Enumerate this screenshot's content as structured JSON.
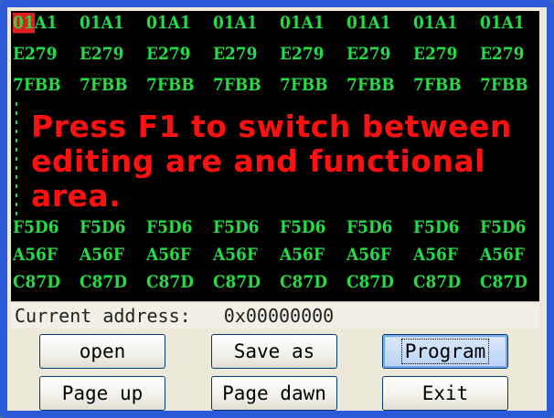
{
  "hex_rows_top": [
    [
      "01A1",
      "01A1",
      "01A1",
      "01A1",
      "01A1",
      "01A1",
      "01A1",
      "01A1"
    ],
    [
      "E279",
      "E279",
      "E279",
      "E279",
      "E279",
      "E279",
      "E279",
      "E279"
    ],
    [
      "7FBB",
      "7FBB",
      "7FBB",
      "7FBB",
      "7FBB",
      "7FBB",
      "7FBB",
      "7FBB"
    ]
  ],
  "hex_rows_bottom": [
    [
      "F5D6",
      "F5D6",
      "F5D6",
      "F5D6",
      "F5D6",
      "F5D6",
      "F5D6",
      "F5D6"
    ],
    [
      "A56F",
      "A56F",
      "A56F",
      "A56F",
      "A56F",
      "A56F",
      "A56F",
      "A56F"
    ],
    [
      "C87D",
      "C87D",
      "C87D",
      "C87D",
      "C87D",
      "C87D",
      "C87D",
      "C87D"
    ]
  ],
  "cursor_prefix": "01",
  "cursor_suffix": "A1",
  "banner": {
    "line1": "Press F1 to switch between",
    "line2": "editing are and functional",
    "line3": "area."
  },
  "status": {
    "label": "Current address:",
    "value": "0x00000000"
  },
  "buttons": {
    "open": "open",
    "save_as": "Save as",
    "program": "Program",
    "page_up": "Page up",
    "page_down": "Page dawn",
    "exit": "Exit"
  },
  "colors": {
    "hex_text": "#22dd44",
    "banner_text": "#ff1010",
    "cursor_highlight": "#e02020",
    "background": "#000000"
  }
}
